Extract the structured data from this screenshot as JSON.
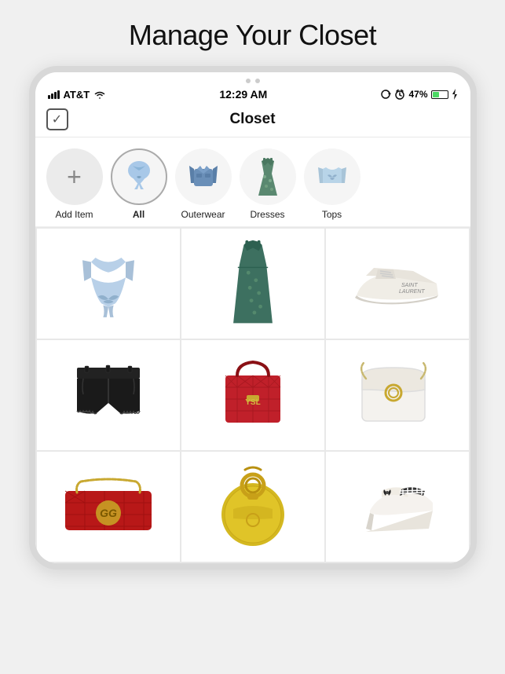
{
  "page": {
    "title": "Manage Your Closet"
  },
  "statusBar": {
    "carrier": "AT&T",
    "time": "12:29 AM",
    "battery": "47%"
  },
  "navBar": {
    "title": "Closet"
  },
  "categories": [
    {
      "id": "add",
      "label": "Add Item",
      "type": "add"
    },
    {
      "id": "all",
      "label": "All",
      "type": "active"
    },
    {
      "id": "outerwear",
      "label": "Outerwear",
      "type": "normal"
    },
    {
      "id": "dresses",
      "label": "Dresses",
      "type": "normal"
    },
    {
      "id": "tops",
      "label": "Tops",
      "type": "normal"
    }
  ],
  "gridItems": [
    {
      "id": "blue-top",
      "emoji": "👚",
      "color": "#c8dcf0"
    },
    {
      "id": "floral-dress",
      "emoji": "👗",
      "color": "#7fb8a0"
    },
    {
      "id": "sneakers",
      "emoji": "👟",
      "color": "#f5f5f0"
    },
    {
      "id": "black-shorts",
      "emoji": "🩳",
      "color": "#2a2a2a"
    },
    {
      "id": "red-bag",
      "emoji": "👜",
      "color": "#c8293a"
    },
    {
      "id": "white-bag",
      "emoji": "👜",
      "color": "#e8e8e8"
    },
    {
      "id": "gucci-bag",
      "emoji": "👜",
      "color": "#c8293a"
    },
    {
      "id": "yellow-bag",
      "emoji": "👜",
      "color": "#e8c940"
    },
    {
      "id": "heels",
      "emoji": "👠",
      "color": "#fff"
    }
  ]
}
